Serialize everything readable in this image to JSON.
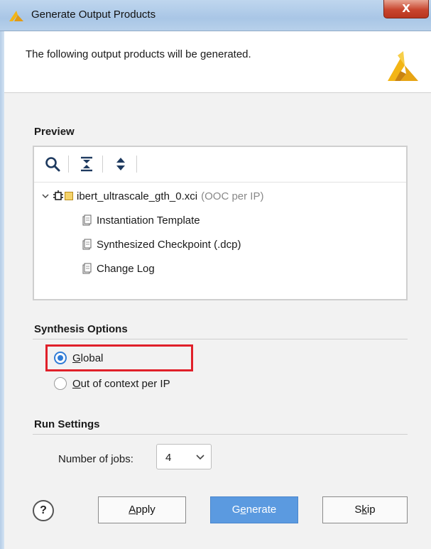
{
  "window": {
    "title": "Generate Output Products",
    "close_glyph": "X"
  },
  "header": {
    "message": "The following output products will be generated."
  },
  "preview": {
    "title": "Preview",
    "toolbar": {
      "icons": [
        "search-icon",
        "collapse-all-icon",
        "expand-all-icon"
      ]
    },
    "root": {
      "name": "ibert_ultrascale_gth_0.xci",
      "suffix": "(OOC per IP)"
    },
    "items": [
      "Instantiation Template",
      "Synthesized Checkpoint (.dcp)",
      "Change Log"
    ]
  },
  "synthesis": {
    "title": "Synthesis Options",
    "options": [
      {
        "mnemonic": "G",
        "rest": "lobal",
        "selected": true
      },
      {
        "mnemonic": "O",
        "rest": "ut of context per IP",
        "selected": false
      }
    ]
  },
  "run": {
    "title": "Run Settings",
    "jobs_label": "Number of jobs:",
    "jobs_value": "4"
  },
  "buttons": {
    "help": "?",
    "apply": {
      "mnemonic": "A",
      "rest": "pply"
    },
    "generate": {
      "pre": "G",
      "mnemonic": "e",
      "rest": "nerate"
    },
    "skip": {
      "pre": "S",
      "mnemonic": "k",
      "rest": "ip"
    }
  },
  "colors": {
    "accent": "#2f7bd6",
    "primary_button": "#5b9ae0",
    "highlight": "#e0202a",
    "logo": "#f3b515"
  }
}
